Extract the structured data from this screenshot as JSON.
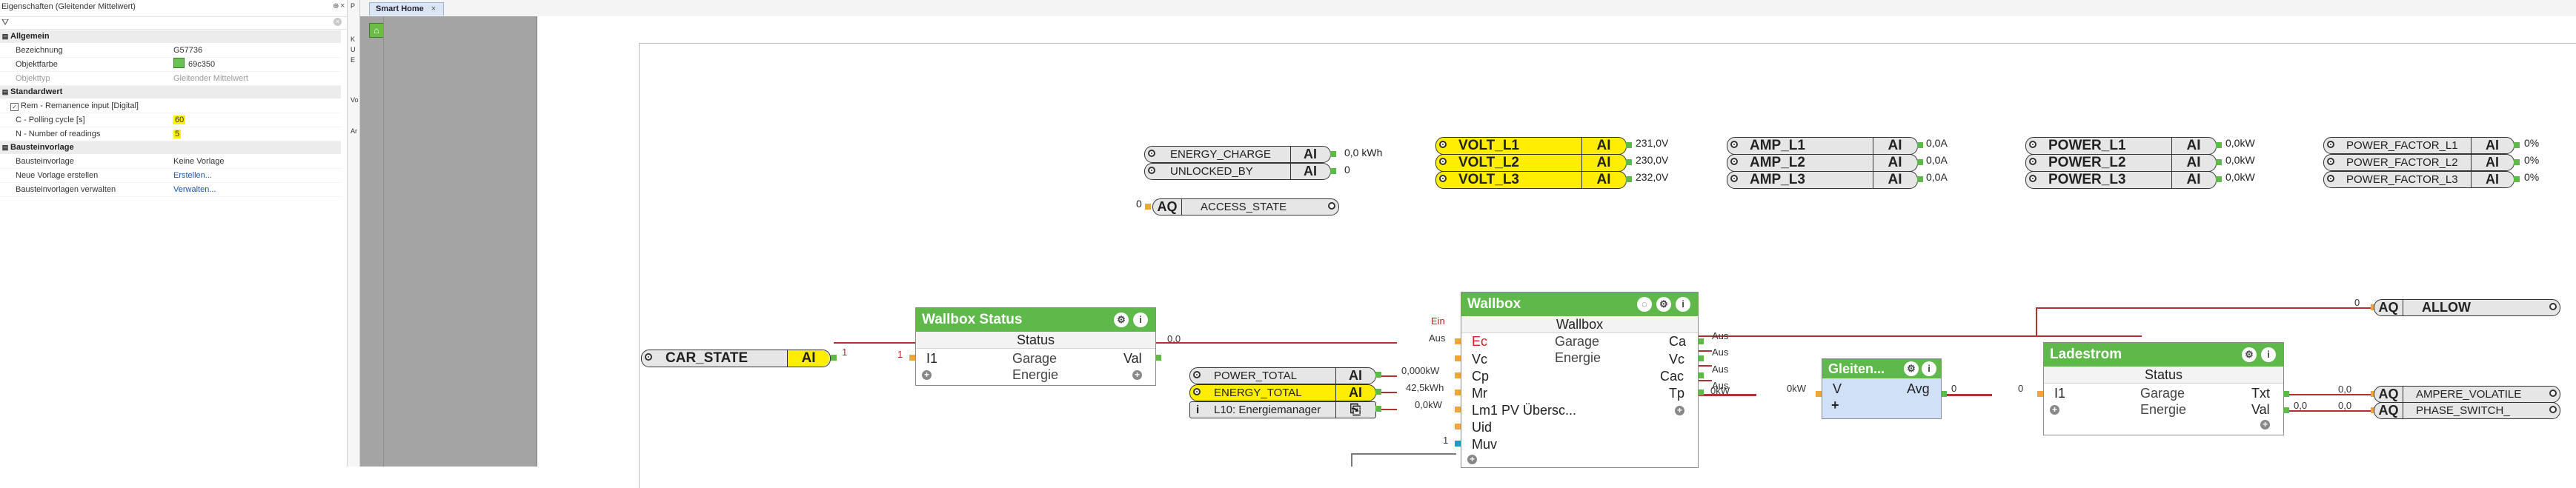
{
  "properties": {
    "title": "Eigenschaften (Gleitender Mittelwert)",
    "pin": "⊕",
    "close": "×",
    "filter_icon": "filter-icon",
    "sections": [
      {
        "label": "Allgemein"
      },
      {
        "label": "Standardwert"
      },
      {
        "label": "Bausteinvorlage"
      }
    ],
    "rows": {
      "bezeichnung": {
        "key": "Bezeichnung",
        "value": "G57736"
      },
      "objektfarbe": {
        "key": "Objektfarbe",
        "value": "69c350",
        "color": "#69c350"
      },
      "objekttyp": {
        "key": "Objekttyp",
        "value": "Gleitender Mittelwert"
      },
      "rem": {
        "key": "Rem - Remanence input [Digital]"
      },
      "polling": {
        "key": "C - Polling cycle [s]",
        "value": "60"
      },
      "readings": {
        "key": "N - Number of readings",
        "value": "5"
      },
      "vorlage": {
        "key": "Bausteinvorlage",
        "value": "Keine Vorlage"
      },
      "neue": {
        "key": "Neue Vorlage erstellen",
        "value": "Erstellen..."
      },
      "verwalten": {
        "key": "Bausteinvorlagen verwalten",
        "value": "Verwalten..."
      }
    }
  },
  "strip": [
    "P",
    "K",
    "U",
    "E",
    "Vo",
    "Ar"
  ],
  "tab": {
    "label": "Smart Home",
    "close": "×"
  },
  "io_top": {
    "energy_charge": {
      "name": "ENERGY_CHARGE",
      "type": "AI",
      "value": "0,0 kWh"
    },
    "unlocked_by": {
      "name": "UNLOCKED_BY",
      "type": "AI",
      "value": "0"
    },
    "access_state": {
      "name": "ACCESS_STATE",
      "type": "AQ",
      "value": "0"
    },
    "volt": [
      {
        "name": "VOLT_L1",
        "type": "AI",
        "value": "231,0V"
      },
      {
        "name": "VOLT_L2",
        "type": "AI",
        "value": "230,0V"
      },
      {
        "name": "VOLT_L3",
        "type": "AI",
        "value": "232,0V"
      }
    ],
    "amp": [
      {
        "name": "AMP_L1",
        "type": "AI",
        "value": "0,0A"
      },
      {
        "name": "AMP_L2",
        "type": "AI",
        "value": "0,0A"
      },
      {
        "name": "AMP_L3",
        "type": "AI",
        "value": "0,0A"
      }
    ],
    "power": [
      {
        "name": "POWER_L1",
        "type": "AI",
        "value": "0,0kW"
      },
      {
        "name": "POWER_L2",
        "type": "AI",
        "value": "0,0kW"
      },
      {
        "name": "POWER_L3",
        "type": "AI",
        "value": "0,0kW"
      }
    ],
    "pf": [
      {
        "name": "POWER_FACTOR_L1",
        "type": "AI",
        "value": "0%"
      },
      {
        "name": "POWER_FACTOR_L2",
        "type": "AI",
        "value": "0%"
      },
      {
        "name": "POWER_FACTOR_L3",
        "type": "AI",
        "value": "0%"
      }
    ]
  },
  "car_state": {
    "name": "CAR_STATE",
    "type": "AI",
    "value": "1"
  },
  "wallbox_status": {
    "title": "Wallbox Status",
    "sub": "Status",
    "in": "I1",
    "room": "Garage",
    "cat": "Energie",
    "out": "Val",
    "in_val": "1",
    "out_val": "0,0"
  },
  "mid_inputs": {
    "power_total": {
      "name": "POWER_TOTAL",
      "type": "AI",
      "value": "0,000kW"
    },
    "energy_total": {
      "name": "ENERGY_TOTAL",
      "type": "AI",
      "value": "42,5kWh"
    },
    "energiemanager": {
      "name": "L10: Energiemanager",
      "value": "0,0kW"
    }
  },
  "wallbox": {
    "title": "Wallbox",
    "sub": "Wallbox",
    "room": "Garage",
    "cat": "Energie",
    "inputs": [
      "Ec",
      "Vc",
      "Cp",
      "Mr",
      "Lm1 PV Übersc...",
      "Uid",
      "Muv"
    ],
    "outputs": [
      "Ca",
      "Vc",
      "Cac",
      "Tp"
    ],
    "ein_label": "Ein",
    "aus_labels": [
      "Aus",
      "Aus",
      "Aus",
      "Aus"
    ],
    "tp_val": "0kW",
    "muv_val": "1"
  },
  "gleitend": {
    "title": "Gleiten...",
    "in": "V",
    "out": "Avg",
    "in_val": "0kW",
    "out_val": "0"
  },
  "ladestrom": {
    "title": "Ladestrom",
    "sub": "Status",
    "in": "I1",
    "room": "Garage",
    "cat": "Energie",
    "out1": "Txt",
    "out2": "Val",
    "in_val": "0"
  },
  "allow": {
    "name": "ALLOW",
    "type": "AQ",
    "value": "0"
  },
  "ampere_volatile": {
    "name": "AMPERE_VOLATILE",
    "type": "AQ",
    "value": "0,0"
  },
  "phase_switch": {
    "name": "PHASE_SWITCH_",
    "type": "AQ",
    "value": "0,0"
  },
  "icons": [
    "info-icon",
    "gear-icon",
    "circle-icon",
    "add-icon",
    "document-icon"
  ]
}
